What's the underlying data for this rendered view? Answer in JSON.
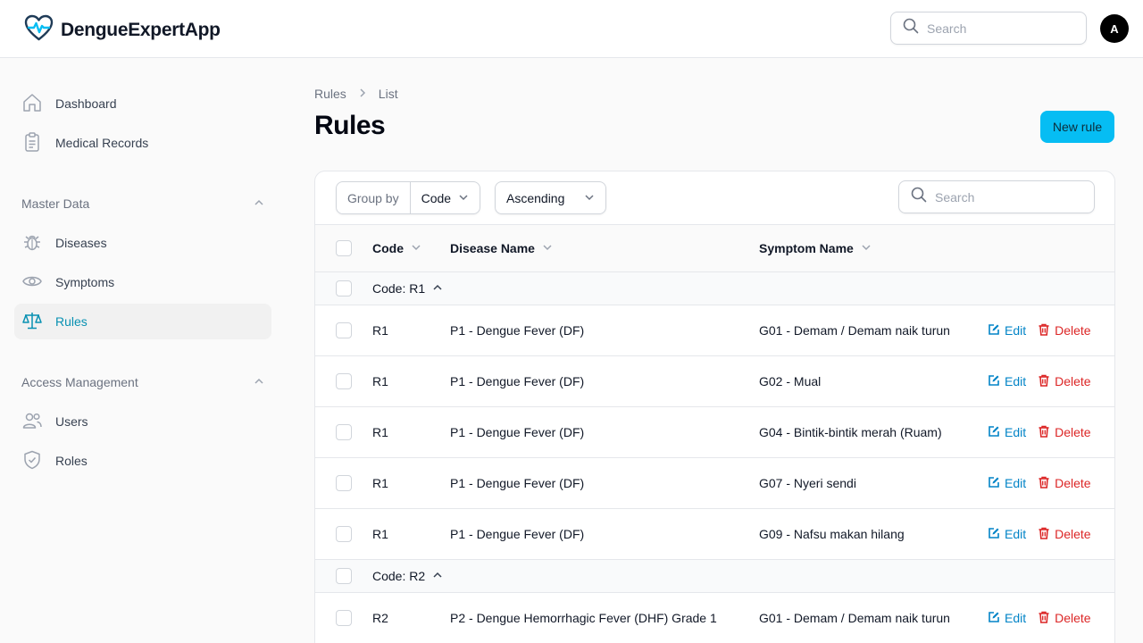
{
  "app": {
    "name": "DengueExpertApp"
  },
  "topbar": {
    "search_placeholder": "Search",
    "avatar_initial": "A"
  },
  "sidebar": {
    "items": [
      {
        "label": "Dashboard"
      },
      {
        "label": "Medical Records"
      }
    ],
    "groups": [
      {
        "label": "Master Data",
        "items": [
          {
            "label": "Diseases"
          },
          {
            "label": "Symptoms"
          },
          {
            "label": "Rules",
            "active": true
          }
        ]
      },
      {
        "label": "Access Management",
        "items": [
          {
            "label": "Users"
          },
          {
            "label": "Roles"
          }
        ]
      }
    ]
  },
  "breadcrumb": [
    "Rules",
    "List"
  ],
  "page": {
    "title": "Rules",
    "new_button": "New rule"
  },
  "toolbar": {
    "group_by_label": "Group by",
    "group_by_value": "Code",
    "order_value": "Ascending",
    "search_placeholder": "Search"
  },
  "table": {
    "columns": [
      "Code",
      "Disease Name",
      "Symptom Name"
    ],
    "edit_label": "Edit",
    "delete_label": "Delete",
    "groups": [
      {
        "label": "Code: R1",
        "rows": [
          {
            "code": "R1",
            "disease": "P1 - Dengue Fever (DF)",
            "symptom": "G01 - Demam / Demam naik turun"
          },
          {
            "code": "R1",
            "disease": "P1 - Dengue Fever (DF)",
            "symptom": "G02 - Mual"
          },
          {
            "code": "R1",
            "disease": "P1 - Dengue Fever (DF)",
            "symptom": "G04 - Bintik-bintik merah (Ruam)"
          },
          {
            "code": "R1",
            "disease": "P1 - Dengue Fever (DF)",
            "symptom": "G07 - Nyeri sendi"
          },
          {
            "code": "R1",
            "disease": "P1 - Dengue Fever (DF)",
            "symptom": "G09 - Nafsu makan hilang"
          }
        ]
      },
      {
        "label": "Code: R2",
        "rows": [
          {
            "code": "R2",
            "disease": "P2 - Dengue Hemorrhagic Fever (DHF) Grade 1",
            "symptom": "G01 - Demam / Demam naik turun"
          }
        ]
      }
    ]
  },
  "colors": {
    "accent": "#06bdf3",
    "active_nav": "#0891b2",
    "edit": "#0284c7",
    "delete": "#dc2626"
  }
}
